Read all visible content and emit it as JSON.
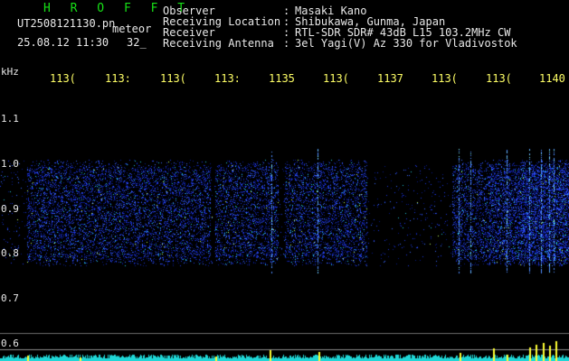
{
  "header": {
    "brand": "H R O F F T",
    "filename": "UT2508121130.pn",
    "filename_suffix": "meteor",
    "timestamp": "25.08.12 11:30",
    "count": "32_"
  },
  "info": [
    {
      "label": "Observer",
      "value": "Masaki Kano"
    },
    {
      "label": "Receiving Location",
      "value": "Shibukawa, Gunma, Japan"
    },
    {
      "label": "Receiver",
      "value": "RTL-SDR SDR# 43dB L15 103.2MHz CW"
    },
    {
      "label": "Receiving Antenna",
      "value": "3el Yagi(V) Az 330 for Vladivostok"
    }
  ],
  "axis": {
    "y_unit": "kHz",
    "x_ticks": [
      "113(",
      "113:",
      "113(",
      "113:",
      "1135",
      "113(",
      "1137",
      "113(",
      "113(",
      "1140"
    ],
    "y_ticks": [
      "1.1",
      "1.0",
      "0.9",
      "0.8",
      "0.7",
      "0.6"
    ]
  },
  "colors": {
    "brand": "#17e017",
    "text": "#e8e8e8",
    "tick": "#ffff66",
    "background": "#000000",
    "signal": "#2f49ff",
    "baseline": "#1fd6d6",
    "spike": "#ffff33"
  }
}
